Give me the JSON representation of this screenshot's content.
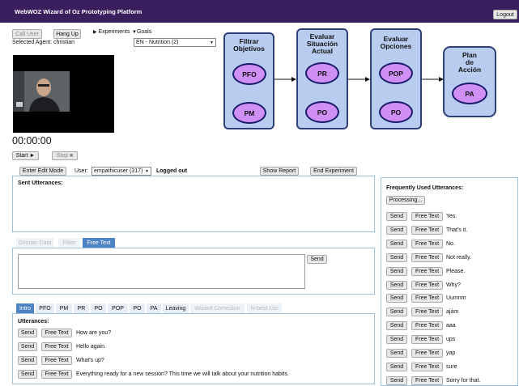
{
  "header": {
    "title": "WebWOZ Wizard of Oz Prototyping Platform",
    "logout_label": "Logout"
  },
  "controls": {
    "call_user": "Call User",
    "hang_up": "Hang Up",
    "selected_agent": "Selected Agent: christian",
    "experiments": "Experiments",
    "goals": "Goals",
    "goal_select_value": "EN - Nutrition (2)"
  },
  "timer": {
    "display": "00:00:00",
    "start_label": "Start ►",
    "stop_label": "Stop ■"
  },
  "diagram": {
    "stages": [
      {
        "title": "Filtrar\nObjetivos",
        "nodes": [
          "PFO",
          "PM"
        ]
      },
      {
        "title": "Evaluar\nSituación\nActual",
        "nodes": [
          "PR",
          "PO"
        ]
      },
      {
        "title": "Evaluar\nOpciones",
        "nodes": [
          "POP",
          "PO"
        ]
      },
      {
        "title": "Plan\nde\nAcción",
        "nodes": [
          "PA"
        ]
      }
    ]
  },
  "session": {
    "edit_mode": "Enter Edit Mode",
    "user_label": "User:",
    "user_value": "empathicuser (317)",
    "status": "Logged out",
    "show_report": "Show Report",
    "end_experiment": "End Experiment"
  },
  "sent": {
    "title": "Sent Utterances:"
  },
  "input_tabs": {
    "items": [
      "Domain Data",
      "Filter",
      "Free Text"
    ],
    "send": "Send"
  },
  "utterance_tabs": {
    "items": [
      "Intro",
      "PFO",
      "PM",
      "PR",
      "PO",
      "POP",
      "PO",
      "PA",
      "Leaving",
      "Wizard Correction",
      "N-best List"
    ],
    "title": "Utterances:",
    "send": "Send",
    "free_text": "Free Text",
    "rows": [
      "How are you?",
      "Hello again.",
      "What's up?",
      "Everything ready for a new session? This time we will talk about your nutrition habits."
    ]
  },
  "frequent": {
    "title": "Frequently Used Utterances:",
    "processing": "Processing...",
    "send": "Send",
    "free_text": "Free Text",
    "rows": [
      "Yes.",
      "That's it.",
      "No.",
      "Not really.",
      "Please.",
      "Why?",
      "Uumnm",
      "ajám",
      "aaa",
      "ups",
      "yap",
      "sure",
      "Sorry for that."
    ]
  },
  "colors": {
    "topbar": "#3a1f5e",
    "stage_fill": "#b8ccf0",
    "node_fill": "#cf8ff5",
    "tab_active": "#4f84c4"
  }
}
